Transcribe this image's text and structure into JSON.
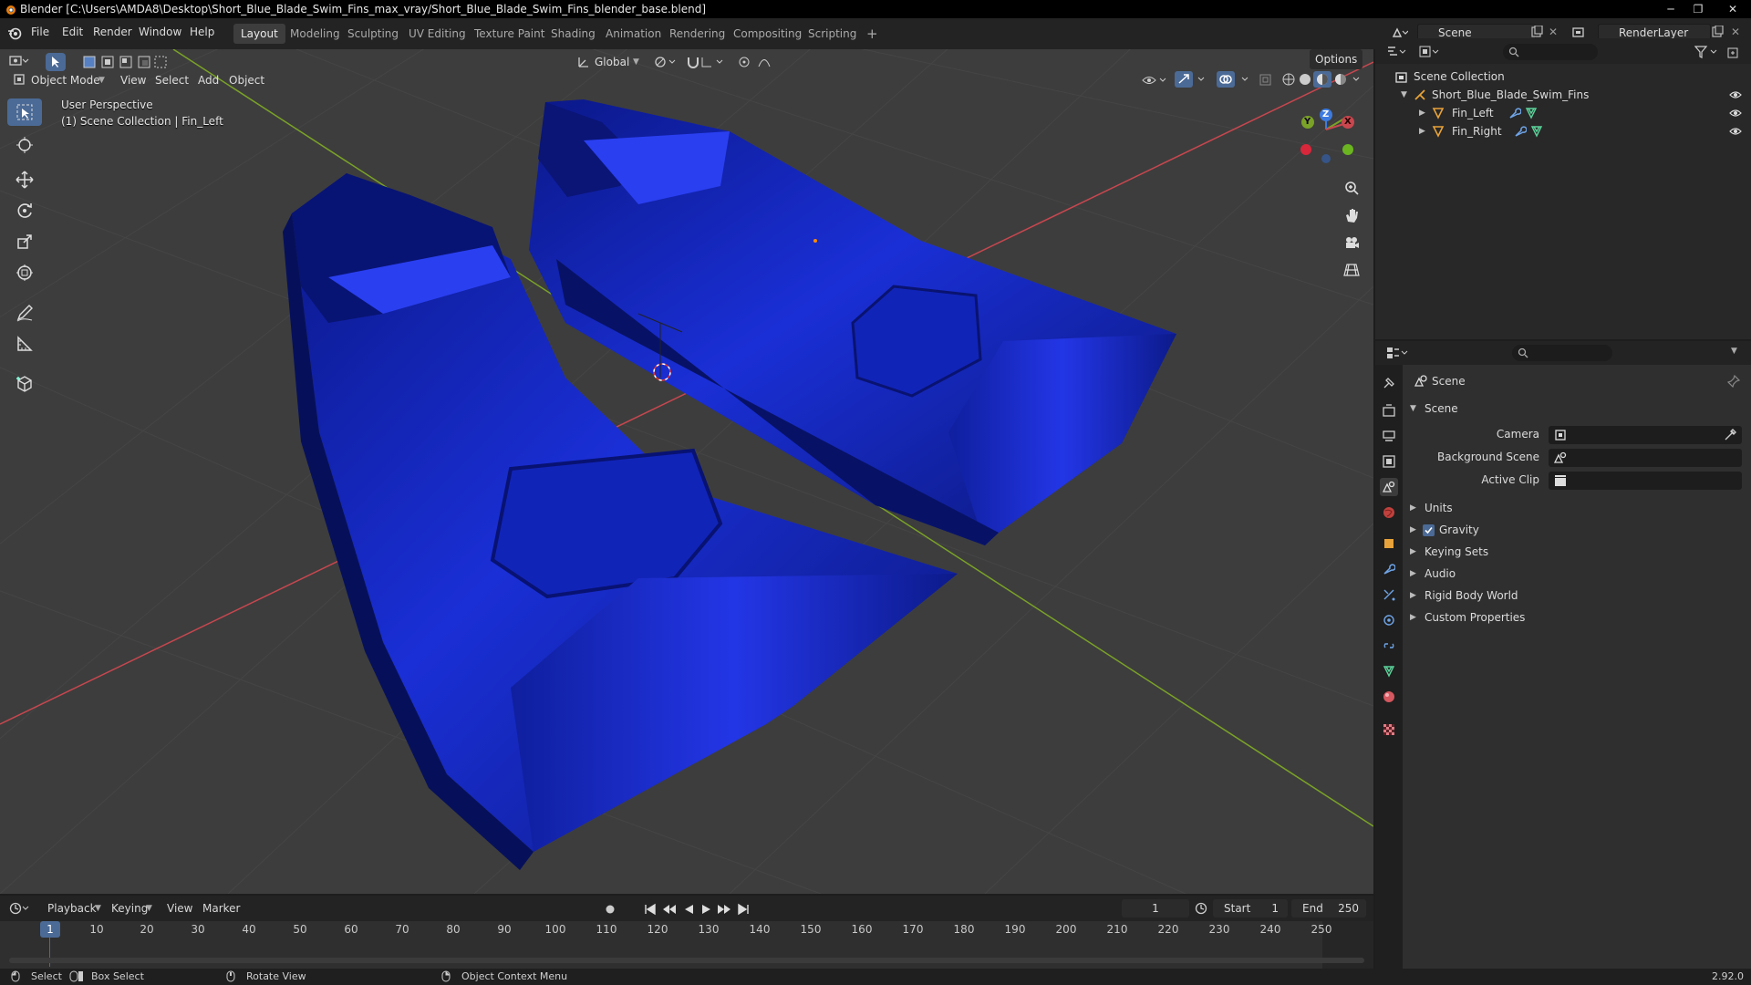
{
  "titlebar": {
    "title": "Blender [C:\\Users\\AMDA8\\Desktop\\Short_Blue_Blade_Swim_Fins_max_vray/Short_Blue_Blade_Swim_Fins_blender_base.blend]",
    "minimize": "─",
    "maximize": "❐",
    "close": "✕"
  },
  "menu": {
    "file": "File",
    "edit": "Edit",
    "render": "Render",
    "window": "Window",
    "help": "Help"
  },
  "workspaces": [
    "Layout",
    "Modeling",
    "Sculpting",
    "UV Editing",
    "Texture Paint",
    "Shading",
    "Animation",
    "Rendering",
    "Compositing",
    "Scripting"
  ],
  "workspace_add": "+",
  "scene_selector": {
    "value": "Scene"
  },
  "view_layer_selector": {
    "value": "RenderLayer"
  },
  "viewport": {
    "mode": "Object Mode",
    "menus": {
      "view": "View",
      "select": "Select",
      "add": "Add",
      "object": "Object"
    },
    "orientation": "Global",
    "options": "Options",
    "perspective": "User Perspective",
    "context": "(1) Scene Collection | Fin_Left",
    "gizmo": {
      "x": "X",
      "y": "Y",
      "z": "Z"
    }
  },
  "outliner": {
    "root": "Scene Collection",
    "collection": "Short_Blue_Blade_Swim_Fins",
    "objects": [
      "Fin_Left",
      "Fin_Right"
    ]
  },
  "properties": {
    "header": "Scene",
    "section": "Scene",
    "camera_label": "Camera",
    "background_scene_label": "Background Scene",
    "active_clip_label": "Active Clip",
    "panels": [
      "Units",
      "Gravity",
      "Keying Sets",
      "Audio",
      "Rigid Body World",
      "Custom Properties"
    ],
    "gravity_enabled": true
  },
  "timeline": {
    "menus": {
      "playback": "Playback",
      "keying": "Keying",
      "view": "View",
      "marker": "Marker"
    },
    "current_frame": "1",
    "start_label": "Start",
    "start_value": "1",
    "end_label": "End",
    "end_value": "250",
    "ticks": [
      "1",
      "10",
      "20",
      "30",
      "40",
      "50",
      "60",
      "70",
      "80",
      "90",
      "100",
      "110",
      "120",
      "130",
      "140",
      "150",
      "160",
      "170",
      "180",
      "190",
      "200",
      "210",
      "220",
      "230",
      "240",
      "250"
    ]
  },
  "statusbar": {
    "select": "Select",
    "box_select": "Box Select",
    "rotate_view": "Rotate View",
    "context_menu": "Object Context Menu",
    "version": "2.92.0"
  },
  "colors": {
    "accent": "#4b6a96",
    "fin_blue": "#1a2fd6",
    "axis_x": "#c8474f",
    "axis_y": "#7aa227",
    "viewport_bg": "#3d3d3d"
  }
}
